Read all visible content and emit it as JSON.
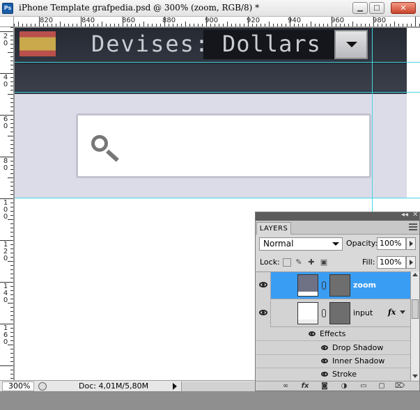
{
  "window": {
    "app_icon": "Ps",
    "title": "iPhone Template grafpedia.psd @ 300% (zoom, RGB/8) *",
    "buttons": {
      "minimize": "minimize-icon",
      "maximize": "maximize-icon",
      "close": "close-icon"
    }
  },
  "rulers": {
    "top_labels": [
      "820",
      "840",
      "860",
      "880",
      "900",
      "920",
      "940",
      "960",
      "980"
    ],
    "left_labels": [
      "20",
      "40",
      "60",
      "80",
      "100",
      "120",
      "140",
      "160"
    ]
  },
  "canvas": {
    "devises_label": "Devises:",
    "currency_value": "Dollars",
    "dropdown_icon": "triangle-down-icon",
    "search_icon": "magnifier-icon",
    "colors": {
      "header": "#2f333c",
      "band": "#dcdbe8",
      "guide": "#44d6e6"
    }
  },
  "status": {
    "zoom": "300%",
    "doc": "Doc: 4,01M/5,80M"
  },
  "layers_panel": {
    "tab": "LAYERS",
    "blend_mode": "Normal",
    "opacity_label": "Opacity:",
    "opacity_value": "100%",
    "lock_label": "Lock:",
    "fill_label": "Fill:",
    "fill_value": "100%",
    "layers": [
      {
        "name": "zoom",
        "selected": true
      },
      {
        "name": "input",
        "selected": false,
        "fx": "fx"
      }
    ],
    "effects_label": "Effects",
    "effects": [
      "Drop Shadow",
      "Inner Shadow",
      "Stroke"
    ],
    "footer_icons": [
      "link-icon",
      "fx-icon",
      "mask-icon",
      "adjustment-icon",
      "folder-icon",
      "new-layer-icon",
      "trash-icon"
    ],
    "selected_color": "#3a9df4"
  }
}
